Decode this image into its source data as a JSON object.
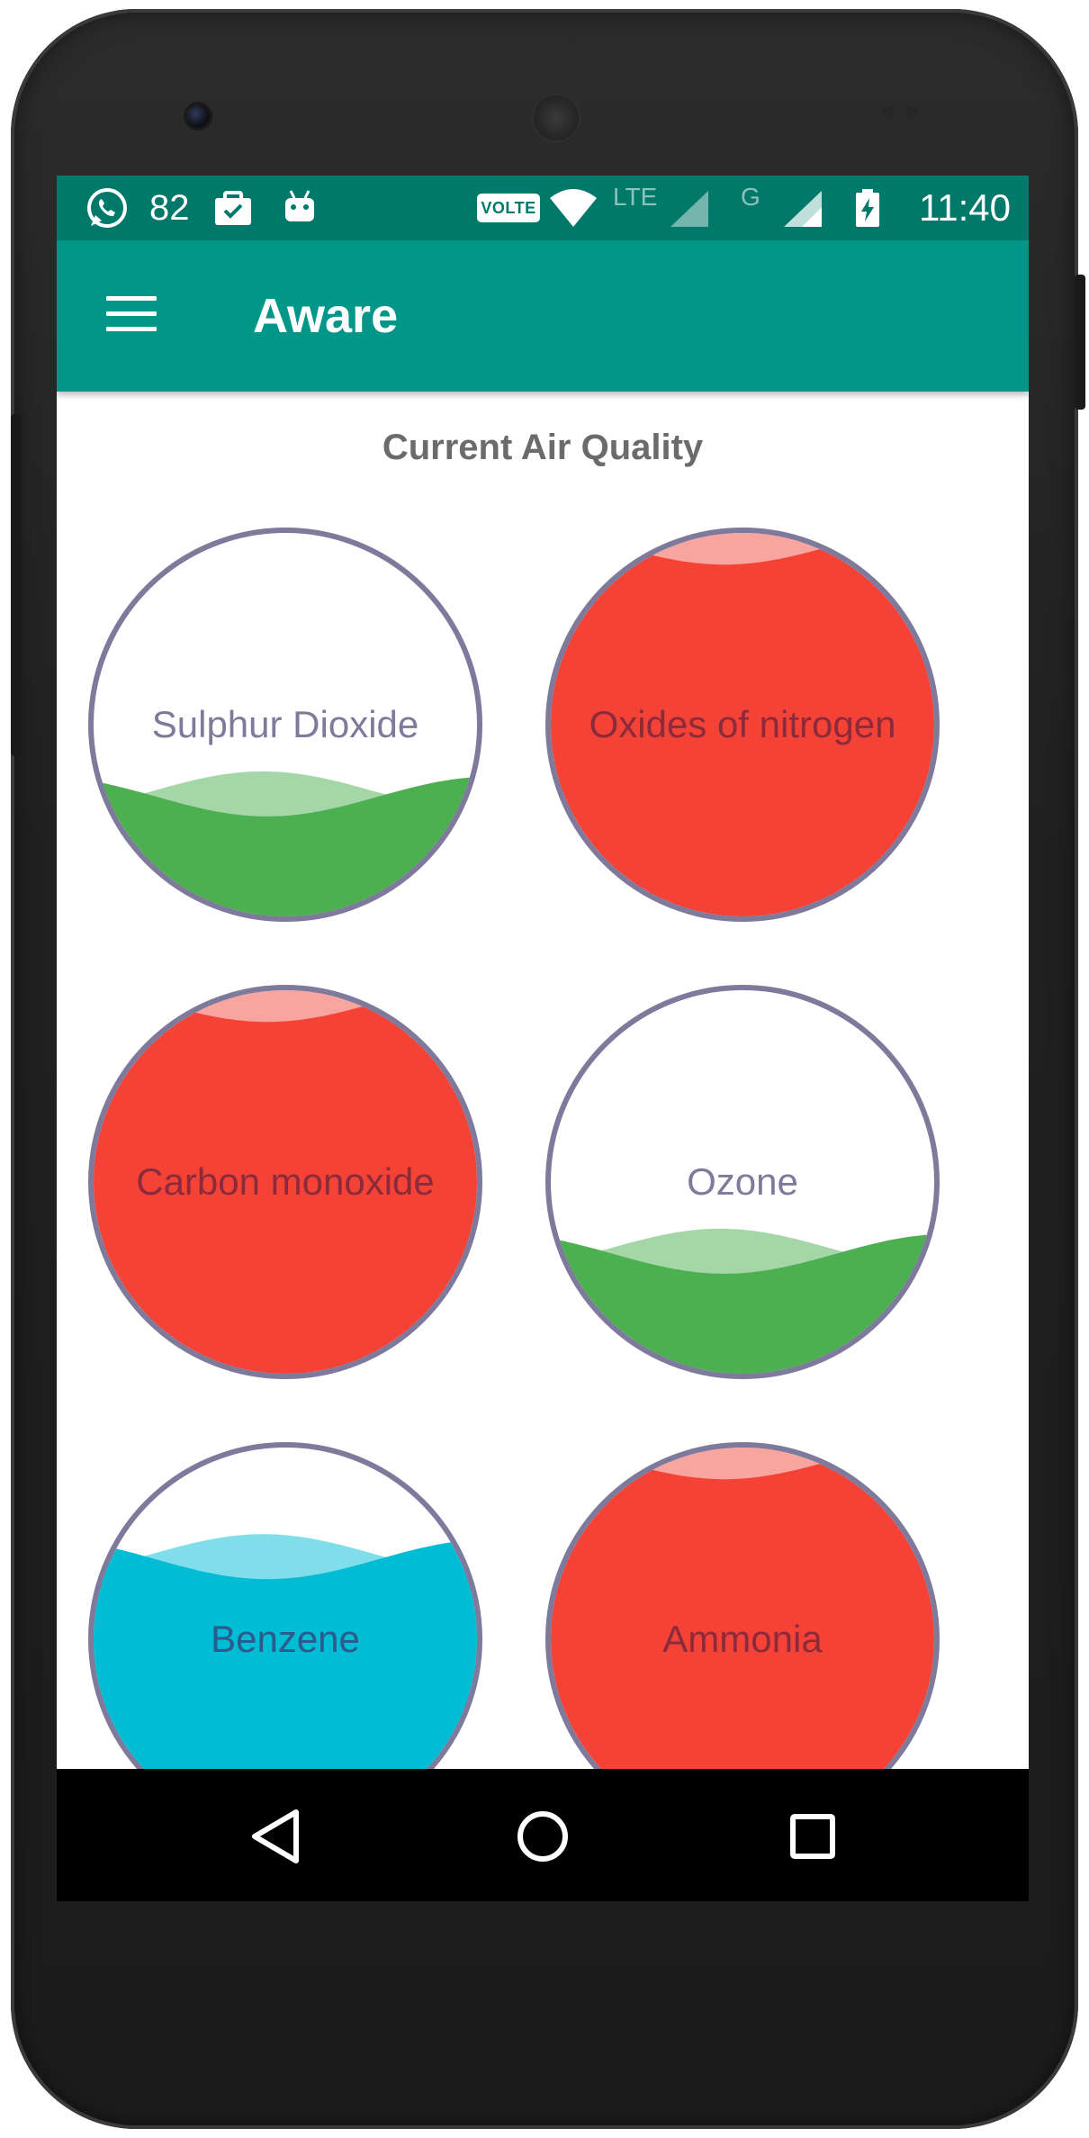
{
  "status_bar": {
    "notification_count": "82",
    "network_badge": "VOLTE",
    "network_type_1": "LTE",
    "network_type_2": "G",
    "clock": "11:40",
    "icons": [
      "whatsapp-icon",
      "briefcase-icon",
      "android-icon",
      "volte-icon",
      "wifi-icon",
      "signal-icon",
      "battery-charging-icon"
    ]
  },
  "app_bar": {
    "title": "Aware",
    "menu_icon": "hamburger-menu-icon"
  },
  "main": {
    "section_title": "Current Air Quality",
    "gauges": [
      {
        "name": "sulphur-dioxide",
        "label": "Sulphur Dioxide",
        "level": 0.32,
        "fill_color": "#4caf50",
        "wave_back_color": "#a5d6a7",
        "label_color": "#7e7a9b"
      },
      {
        "name": "oxides-of-nitrogen",
        "label": "Oxides of nitrogen",
        "level": 0.95,
        "fill_color": "#f44336",
        "wave_back_color": "#f8a5a0",
        "label_color": "#8a2a3a"
      },
      {
        "name": "carbon-monoxide",
        "label": "Carbon monoxide",
        "level": 0.95,
        "fill_color": "#f44336",
        "wave_back_color": "#f8a5a0",
        "label_color": "#8a2a3a"
      },
      {
        "name": "ozone",
        "label": "Ozone",
        "level": 0.32,
        "fill_color": "#4caf50",
        "wave_back_color": "#a5d6a7",
        "label_color": "#7e7a9b"
      },
      {
        "name": "benzene",
        "label": "Benzene",
        "level": 0.7,
        "fill_color": "#00bcd4",
        "wave_back_color": "#80deea",
        "label_color": "#2c5a8a"
      },
      {
        "name": "ammonia",
        "label": "Ammonia",
        "level": 0.95,
        "fill_color": "#f44336",
        "wave_back_color": "#f8a5a0",
        "label_color": "#8a2a3a"
      }
    ],
    "gauge_border_color": "#7e7a9b"
  },
  "nav_bar": {
    "back_icon": "back-triangle-icon",
    "home_icon": "home-circle-icon",
    "recents_icon": "recents-square-icon"
  },
  "colors": {
    "status_bar": "#00796b",
    "app_bar": "#009688"
  }
}
